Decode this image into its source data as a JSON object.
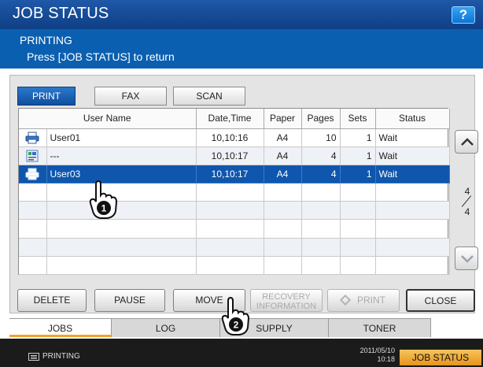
{
  "header": {
    "title": "JOB STATUS",
    "help_label": "?"
  },
  "message": {
    "line1": "PRINTING",
    "line2": "Press [JOB STATUS] to return"
  },
  "mode_tabs": [
    {
      "label": "PRINT",
      "active": true
    },
    {
      "label": "FAX",
      "active": false
    },
    {
      "label": "SCAN",
      "active": false
    }
  ],
  "table": {
    "columns": [
      "User Name",
      "Date,Time",
      "Paper",
      "Pages",
      "Sets",
      "Status"
    ],
    "rows": [
      {
        "icon": "printer-icon",
        "user": "User01",
        "datetime": "10,10:16",
        "paper": "A4",
        "pages": "10",
        "sets": "1",
        "status": "Wait"
      },
      {
        "icon": "document-icon",
        "user": "---",
        "datetime": "10,10:17",
        "paper": "A4",
        "pages": "4",
        "sets": "1",
        "status": "Wait"
      },
      {
        "icon": "printer-icon",
        "user": "User03",
        "datetime": "10,10:17",
        "paper": "A4",
        "pages": "4",
        "sets": "1",
        "status": "Wait"
      }
    ],
    "selected_row": 2
  },
  "pager": {
    "current": "4",
    "total": "4"
  },
  "actions": {
    "delete": "DELETE",
    "pause": "PAUSE",
    "move": "MOVE",
    "recovery_line1": "RECOVERY",
    "recovery_line2": "INFORMATION",
    "print": "PRINT",
    "close": "CLOSE"
  },
  "bottom_tabs": [
    {
      "label": "JOBS",
      "active": true
    },
    {
      "label": "LOG",
      "active": false
    },
    {
      "label": "SUPPLY",
      "active": false
    },
    {
      "label": "TONER",
      "active": false
    }
  ],
  "status_bar": {
    "status_text": "PRINTING",
    "date": "2011/05/10",
    "time": "10:18",
    "job_status_label": "JOB STATUS"
  },
  "callouts": {
    "one": "1",
    "two": "2"
  },
  "colors": {
    "title_blue": "#0f3f86",
    "selected_row": "#0f56ad",
    "accent_orange": "#f0a22a"
  }
}
